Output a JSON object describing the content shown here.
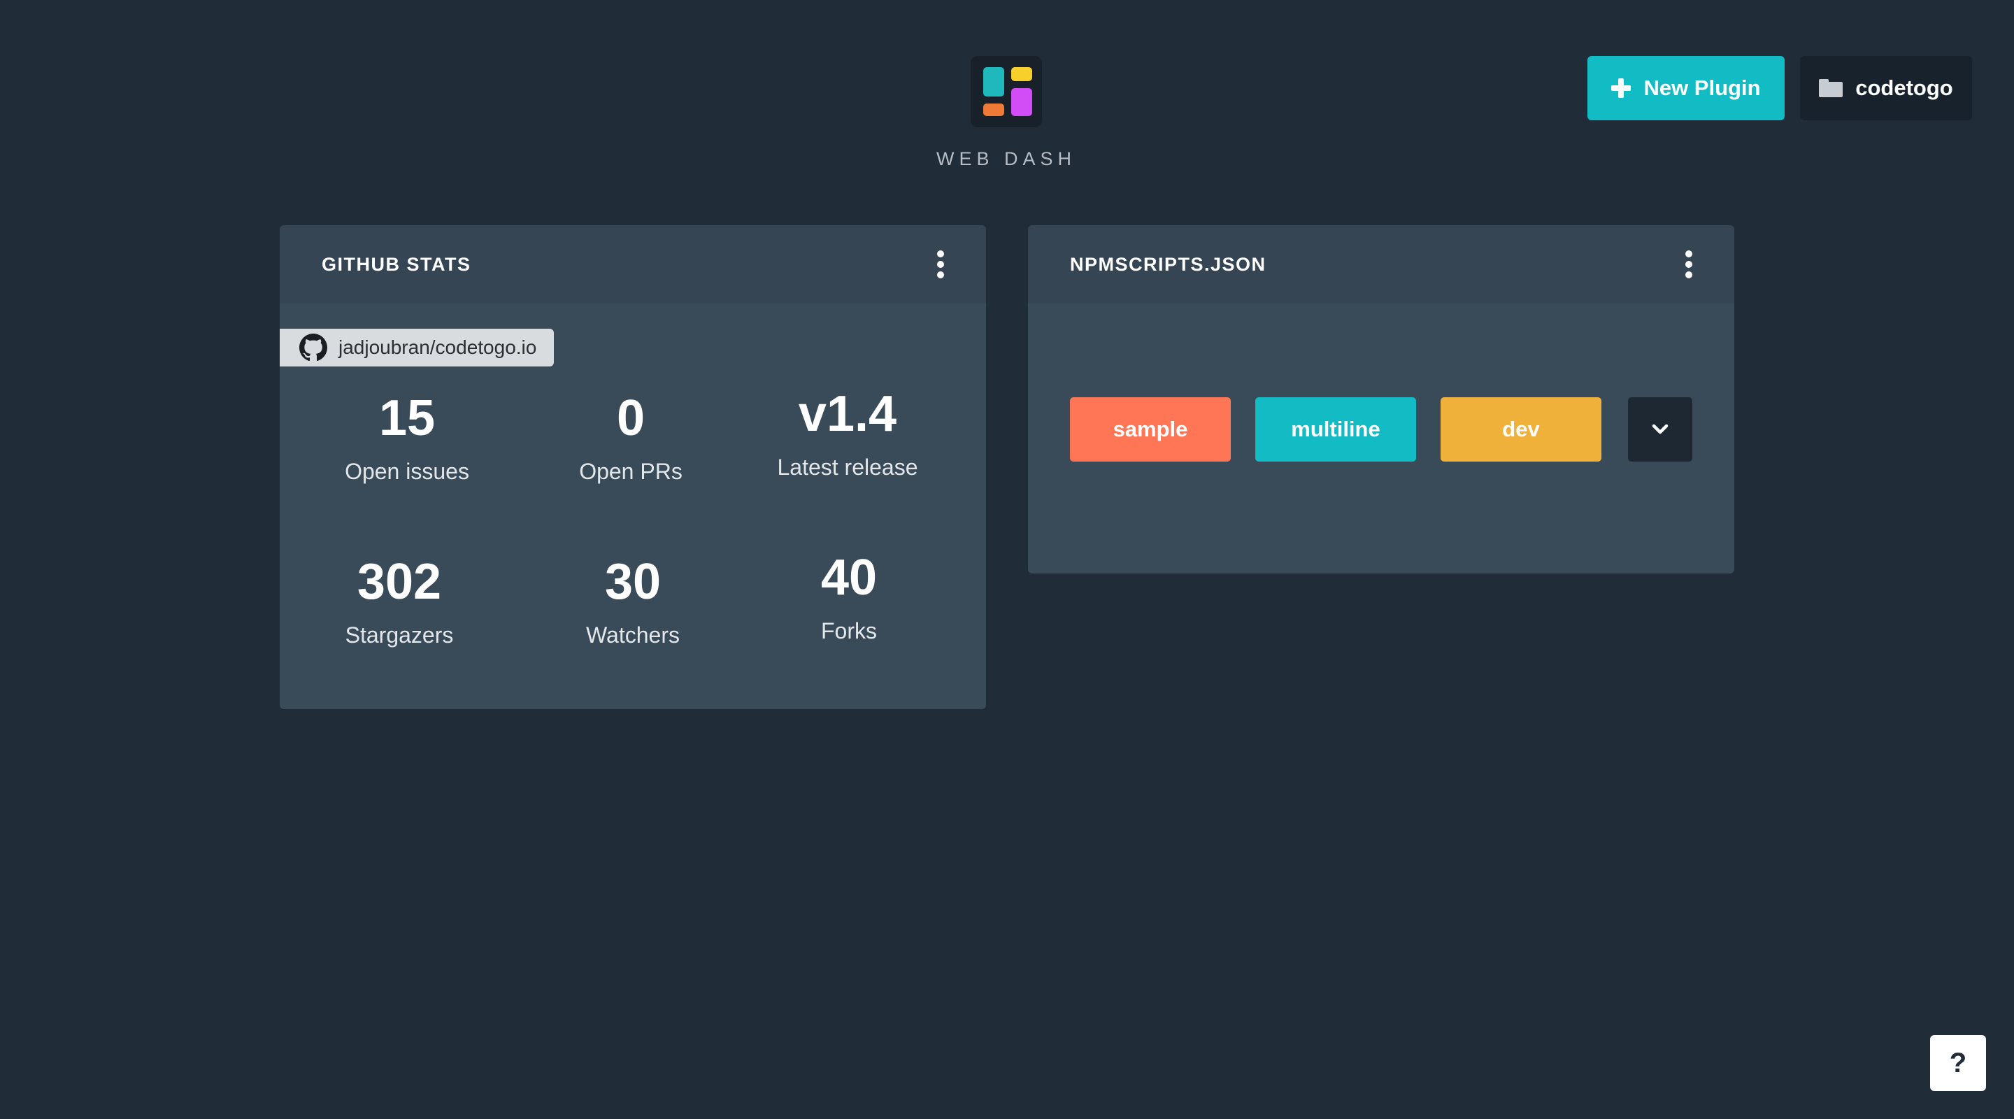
{
  "app": {
    "title": "WEB DASH"
  },
  "toolbar": {
    "new_plugin_label": "New Plugin",
    "project_label": "codetogo",
    "plus_icon": "plus-icon",
    "folder_icon": "folder-icon"
  },
  "colors": {
    "background": "#202c38",
    "card": "#394a59",
    "accent": "#12bcc4",
    "logo": [
      "#1fb8bd",
      "#f8d02c",
      "#ef7a38",
      "#d24df6"
    ]
  },
  "github_stats": {
    "title": "GITHUB STATS",
    "repo": "jadjoubran/codetogo.io",
    "repo_icon": "github-icon",
    "stats": [
      {
        "value": "15",
        "label": "Open issues"
      },
      {
        "value": "0",
        "label": "Open PRs"
      },
      {
        "value": "v1.4",
        "label": "Latest release"
      },
      {
        "value": "302",
        "label": "Stargazers"
      },
      {
        "value": "30",
        "label": "Watchers"
      },
      {
        "value": "40",
        "label": "Forks"
      }
    ]
  },
  "npm_scripts": {
    "title": "NPMSCRIPTS.JSON",
    "scripts": [
      {
        "label": "sample",
        "color": "#fe7655"
      },
      {
        "label": "multiline",
        "color": "#13bcc4"
      },
      {
        "label": "dev",
        "color": "#f0b13b"
      }
    ],
    "more_icon": "chevron-down-icon"
  },
  "help": {
    "label": "?"
  }
}
